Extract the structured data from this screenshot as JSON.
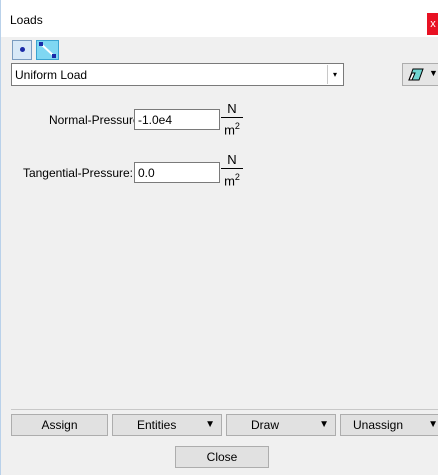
{
  "window": {
    "title": "Loads",
    "close_glyph": "x"
  },
  "toolbar": {
    "point_tool_icon": "point-icon",
    "line_tool_icon": "line-icon"
  },
  "load_type": {
    "selected": "Uniform Load",
    "arrow_glyph": "▾"
  },
  "eraser": {
    "icon": "eraser-icon",
    "caret": "▼"
  },
  "fields": [
    {
      "label": "Normal-Pressure:",
      "value": "-1.0e4",
      "unit_num": "N",
      "unit_den": "m",
      "unit_exp": "2"
    },
    {
      "label": "Tangential-Pressure:",
      "value": "0.0",
      "unit_num": "N",
      "unit_den": "m",
      "unit_exp": "2"
    }
  ],
  "actions": {
    "assign": "Assign",
    "entities": "Entities",
    "draw": "Draw",
    "unassign": "Unassign",
    "caret": "▼"
  },
  "close_label": "Close",
  "colors": {
    "window_bg": "#f0f0f0",
    "close_red": "#e81123",
    "line_tool": "#7fd7f2"
  }
}
